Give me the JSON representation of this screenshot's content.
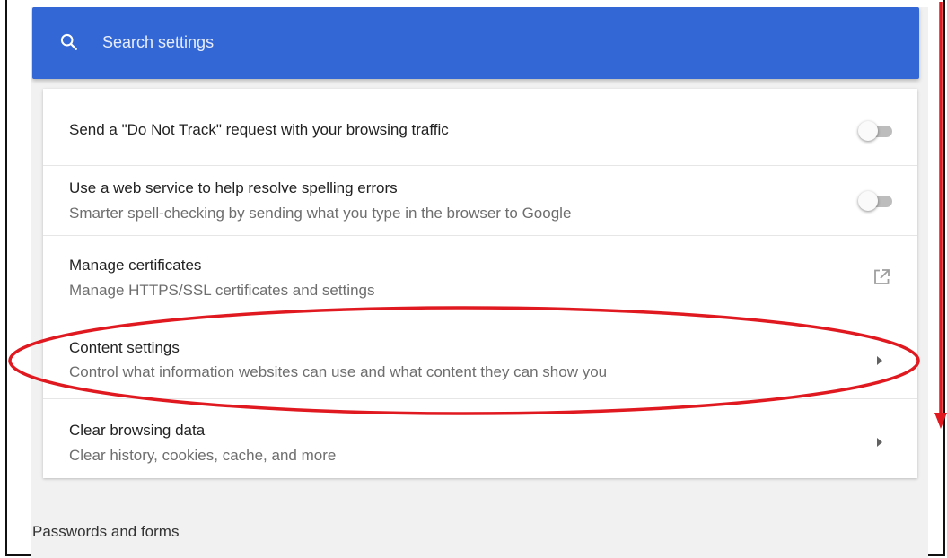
{
  "search": {
    "label": "Search settings",
    "icon": "search-icon"
  },
  "settings": {
    "do_not_track": {
      "title": "Send a \"Do Not Track\" request with your browsing traffic",
      "enabled": false
    },
    "spelling": {
      "title": "Use a web service to help resolve spelling errors",
      "subtitle": "Smarter spell-checking by sending what you type in the browser to Google",
      "enabled": false
    },
    "certificates": {
      "title": "Manage certificates",
      "subtitle": "Manage HTTPS/SSL certificates and settings",
      "icon": "external-link-icon"
    },
    "content": {
      "title": "Content settings",
      "subtitle": "Control what information websites can use and what content they can show you",
      "icon": "chevron-right-icon"
    },
    "clear_data": {
      "title": "Clear browsing data",
      "subtitle": "Clear history, cookies, cache, and more",
      "icon": "chevron-right-icon"
    }
  },
  "sections": {
    "passwords_header": "Passwords and forms"
  },
  "colors": {
    "header_blue": "#3367d6",
    "annotation_red": "#e0181f",
    "toggle_off_track": "#bdbdbd"
  }
}
